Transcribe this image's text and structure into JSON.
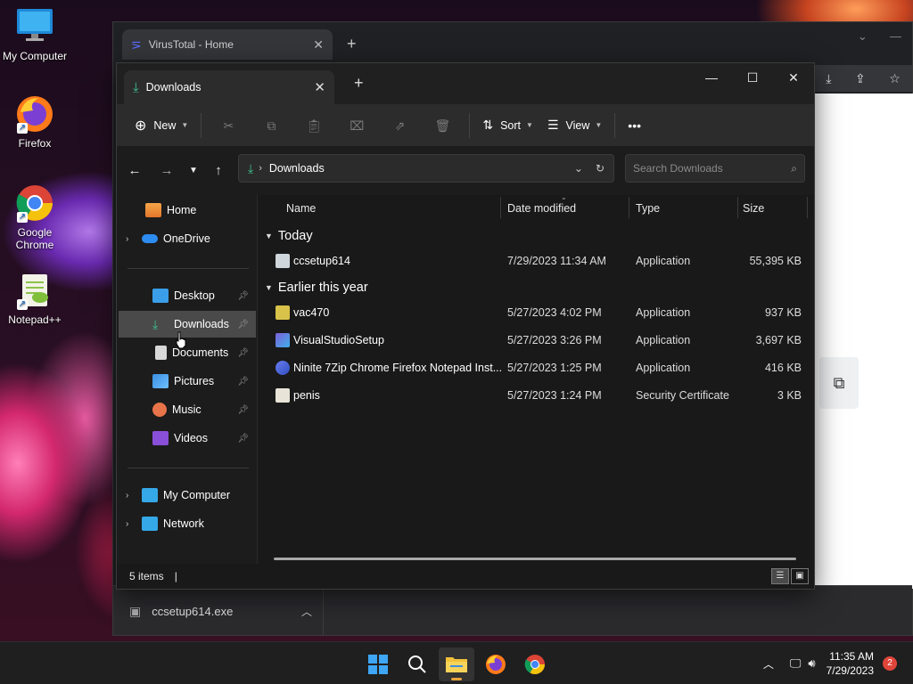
{
  "desktop": {
    "icons": [
      {
        "label": "My Computer"
      },
      {
        "label": "Firefox"
      },
      {
        "label": "Google Chrome"
      },
      {
        "label": "Notepad++"
      }
    ]
  },
  "browser": {
    "tab_title": "VirusTotal - Home",
    "download_bar": {
      "file": "ccsetup614.exe"
    }
  },
  "explorer": {
    "tab_title": "Downloads",
    "toolbar": {
      "new_label": "New",
      "sort_label": "Sort",
      "view_label": "View",
      "more_label": "•••"
    },
    "address": {
      "crumb": "Downloads"
    },
    "search": {
      "placeholder": "Search Downloads"
    },
    "sidebar": {
      "home": "Home",
      "onedrive": "OneDrive",
      "desktop": "Desktop",
      "downloads": "Downloads",
      "documents": "Documents",
      "pictures": "Pictures",
      "music": "Music",
      "videos": "Videos",
      "my_computer": "My Computer",
      "network": "Network"
    },
    "columns": {
      "name": "Name",
      "date": "Date modified",
      "type": "Type",
      "size": "Size"
    },
    "groups": {
      "today": "Today",
      "earlier": "Earlier this year"
    },
    "files": [
      {
        "name": "ccsetup614",
        "date": "7/29/2023 11:34 AM",
        "type": "Application",
        "size": "55,395 KB"
      },
      {
        "name": "vac470",
        "date": "5/27/2023 4:02 PM",
        "type": "Application",
        "size": "937 KB"
      },
      {
        "name": "VisualStudioSetup",
        "date": "5/27/2023 3:26 PM",
        "type": "Application",
        "size": "3,697 KB"
      },
      {
        "name": "Ninite 7Zip Chrome Firefox Notepad Inst...",
        "date": "5/27/2023 1:25 PM",
        "type": "Application",
        "size": "416 KB"
      },
      {
        "name": "penis",
        "date": "5/27/2023 1:24 PM",
        "type": "Security Certificate",
        "size": "3 KB"
      }
    ],
    "status": {
      "items": "5 items",
      "sep": "|"
    }
  },
  "taskbar": {
    "time": "11:35 AM",
    "date": "7/29/2023",
    "notifications": "2"
  },
  "colors": {
    "accent": "#e9a23b",
    "selection": "#4a4a4a",
    "window_bg": "#191919"
  }
}
